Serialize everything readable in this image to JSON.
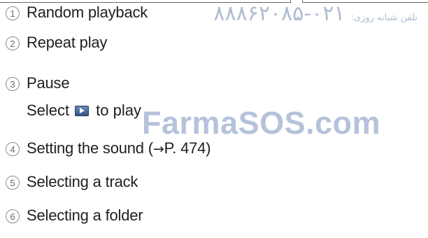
{
  "items": [
    {
      "num": "1",
      "label": "Random playback"
    },
    {
      "num": "2",
      "label": "Repeat play"
    },
    {
      "num": "3",
      "label": "Pause",
      "sub_before": "Select",
      "sub_after": "to play"
    },
    {
      "num": "4",
      "label": "Setting the sound (",
      "arrow": "→",
      "label_after": "P. 474)"
    },
    {
      "num": "5",
      "label": "Selecting a track"
    },
    {
      "num": "6",
      "label": "Selecting a folder"
    }
  ],
  "watermark": {
    "site": "FarmaSOS.com",
    "phone_label": "تلفن شبانه روزی:",
    "phone_digits": "۰۲۱-۸۸۸۶۲۰۸۵"
  },
  "colors": {
    "text": "#1f1f1f",
    "number_circle": "#8c8c8c",
    "watermark": "#a9b8d4",
    "play_icon": "#2f4f7f"
  },
  "icons": {
    "play": "play-icon"
  }
}
